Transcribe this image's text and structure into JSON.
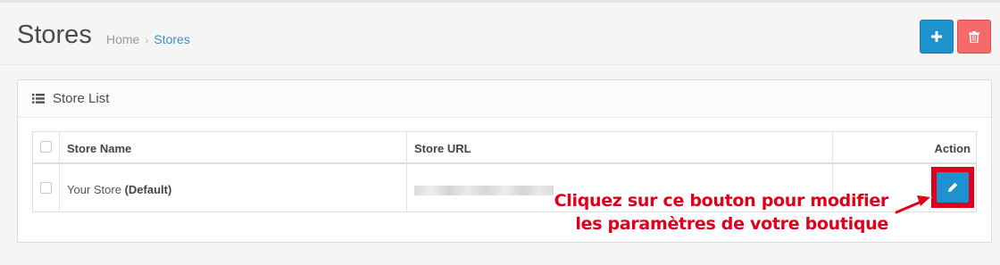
{
  "header": {
    "title": "Stores",
    "breadcrumb": [
      {
        "label": "Home"
      },
      {
        "label": "Stores"
      }
    ],
    "add_icon": "plus-icon",
    "delete_icon": "trash-icon",
    "colors": {
      "primary": "#1e91cf",
      "danger": "#f56b6b",
      "link": "#3e8ec4"
    }
  },
  "panel": {
    "icon": "list-icon",
    "title": "Store List"
  },
  "table": {
    "columns": [
      "Store Name",
      "Store URL",
      "Action"
    ],
    "rows": [
      {
        "name": "Your Store",
        "default_tag": "(Default)",
        "url_obscured": true,
        "action_icon": "pencil-icon"
      }
    ]
  },
  "annotation": {
    "line1": "Cliquez sur ce bouton pour modifier",
    "line2": "les paramètres de votre boutique",
    "color": "#e0001b"
  }
}
